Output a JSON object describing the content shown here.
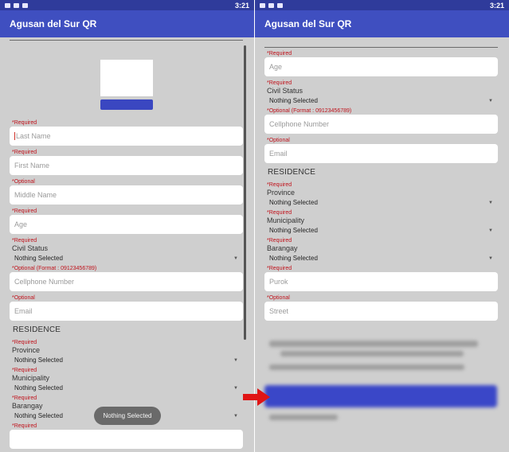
{
  "status": {
    "time": "3:21"
  },
  "app": {
    "title": "Agusan del Sur QR"
  },
  "left": {
    "last_name": {
      "tag": "*Required",
      "placeholder": "Last Name"
    },
    "first_name": {
      "tag": "*Required",
      "placeholder": "First Name"
    },
    "middle_name": {
      "tag": "*Optional",
      "placeholder": "Middle Name"
    },
    "age": {
      "tag": "*Required",
      "placeholder": "Age"
    },
    "civil_status": {
      "tag": "*Required",
      "label": "Civil Status",
      "value": "Nothing Selected"
    },
    "cellphone": {
      "tag": "*Optional (Format : 09123456789)",
      "placeholder": "Cellphone Number"
    },
    "email": {
      "tag": "*Optional",
      "placeholder": "Email"
    },
    "residence": "RESIDENCE",
    "province": {
      "tag": "*Required",
      "label": "Province",
      "value": "Nothing Selected"
    },
    "municipality": {
      "tag": "*Required",
      "label": "Municipality",
      "value": "Nothing Selected"
    },
    "barangay": {
      "tag": "*Required",
      "label": "Barangay",
      "value": "Nothing Selected"
    },
    "last_tag": "*Required",
    "toast": "Nothing Selected"
  },
  "right": {
    "age": {
      "tag": "*Required",
      "placeholder": "Age"
    },
    "civil_status": {
      "tag": "*Required",
      "label": "Civil Status",
      "value": "Nothing Selected"
    },
    "cellphone": {
      "tag": "*Optional (Format : 09123456789)",
      "placeholder": "Cellphone Number"
    },
    "email": {
      "tag": "*Optional",
      "placeholder": "Email"
    },
    "residence": "RESIDENCE",
    "province": {
      "tag": "*Required",
      "label": "Province",
      "value": "Nothing Selected"
    },
    "municipality": {
      "tag": "*Required",
      "label": "Municipality",
      "value": "Nothing Selected"
    },
    "barangay": {
      "tag": "*Required",
      "label": "Barangay",
      "value": "Nothing Selected"
    },
    "purok": {
      "tag": "*Required",
      "placeholder": "Purok"
    },
    "street": {
      "tag": "*Optional",
      "placeholder": "Street"
    }
  },
  "colors": {
    "appbar": "#3f4fc0",
    "statusbar": "#2f3b9b",
    "required": "#c0121b",
    "arrow": "#e01515"
  }
}
